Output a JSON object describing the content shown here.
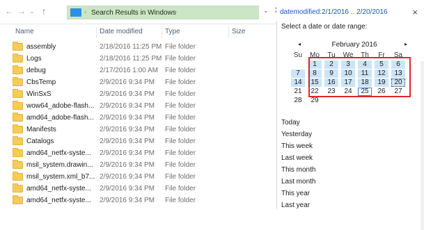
{
  "nav": {
    "back_icon": "arrow-left",
    "forward_icon": "arrow-right",
    "recent_icon": "chevron-down",
    "up_icon": "arrow-up"
  },
  "address": {
    "path": "Search Results in Windows",
    "separator": "›"
  },
  "search": {
    "query": "datemodified:2/1/2016 .. 2/20/2016",
    "clear_label": "×",
    "dropdown_label": "⌄",
    "address_clear_label": "✕"
  },
  "columns": {
    "name": "Name",
    "date": "Date modified",
    "type": "Type",
    "size": "Size"
  },
  "files": [
    {
      "name": "assembly",
      "date": "2/18/2016 11:25 PM",
      "type": "File folder"
    },
    {
      "name": "Logs",
      "date": "2/18/2016 11:25 PM",
      "type": "File folder"
    },
    {
      "name": "debug",
      "date": "2/17/2016 1:00 AM",
      "type": "File folder"
    },
    {
      "name": "CbsTemp",
      "date": "2/9/2016 9:34 PM",
      "type": "File folder"
    },
    {
      "name": "WinSxS",
      "date": "2/9/2016 9:34 PM",
      "type": "File folder"
    },
    {
      "name": "wow64_adobe-flash...",
      "date": "2/9/2016 9:34 PM",
      "type": "File folder"
    },
    {
      "name": "amd64_adobe-flash...",
      "date": "2/9/2016 9:34 PM",
      "type": "File folder"
    },
    {
      "name": "Manifests",
      "date": "2/9/2016 9:34 PM",
      "type": "File folder"
    },
    {
      "name": "Catalogs",
      "date": "2/9/2016 9:34 PM",
      "type": "File folder"
    },
    {
      "name": "amd64_netfx-syste...",
      "date": "2/9/2016 9:34 PM",
      "type": "File folder"
    },
    {
      "name": "msil_system.drawin...",
      "date": "2/9/2016 9:34 PM",
      "type": "File folder"
    },
    {
      "name": "msil_system.xml_b7...",
      "date": "2/9/2016 9:34 PM",
      "type": "File folder"
    },
    {
      "name": "amd64_netfx-syste...",
      "date": "2/9/2016 9:34 PM",
      "type": "File folder"
    },
    {
      "name": "amd64_netfx-syste...",
      "date": "2/9/2016 9:34 PM",
      "type": "File folder"
    }
  ],
  "datepicker": {
    "prompt": "Select a date or date range:",
    "month_label": "February 2016",
    "prev_label": "◂",
    "next_label": "▸",
    "weekdays": [
      "Su",
      "Mo",
      "Tu",
      "We",
      "Th",
      "Fr",
      "Sa"
    ],
    "weeks": [
      [
        "",
        "1",
        "2",
        "3",
        "4",
        "5",
        "6"
      ],
      [
        "7",
        "8",
        "9",
        "10",
        "11",
        "12",
        "13"
      ],
      [
        "14",
        "15",
        "16",
        "17",
        "18",
        "19",
        "20"
      ],
      [
        "21",
        "22",
        "23",
        "24",
        "25",
        "26",
        "27"
      ],
      [
        "28",
        "29",
        "",
        "",
        "",
        "",
        ""
      ]
    ],
    "range_start_day": 1,
    "range_end_day": 20,
    "today_day": 25,
    "quick_options": [
      "Today",
      "Yesterday",
      "This week",
      "Last week",
      "This month",
      "Last month",
      "This year",
      "Last year"
    ]
  },
  "colors": {
    "highlight_red": "#e0252b",
    "selection_blue": "#cce4f7",
    "folder_yellow": "#f5cc57",
    "path_green": "#cbe6c4",
    "search_text_blue": "#1b55c5"
  }
}
